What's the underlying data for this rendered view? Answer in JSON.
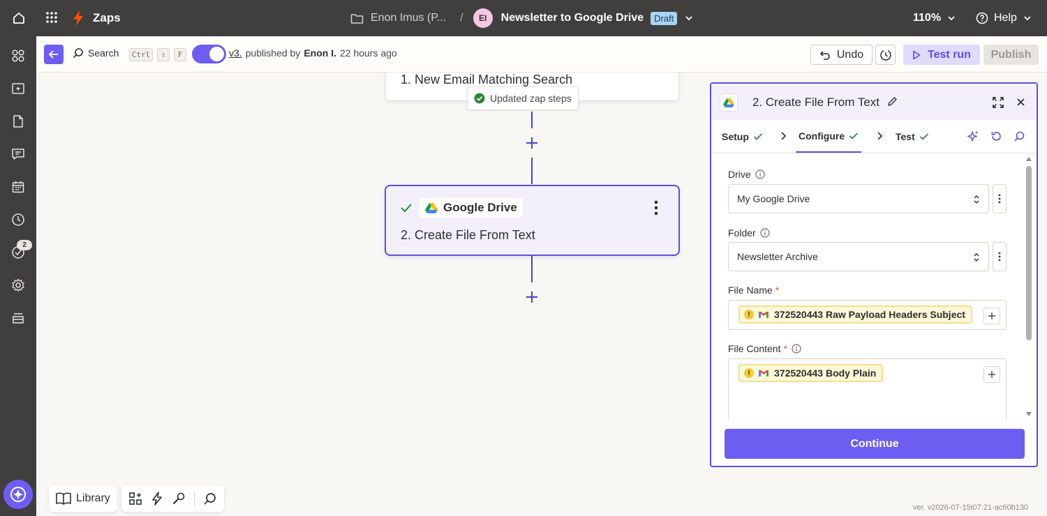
{
  "topbar": {
    "app_name": "Zaps",
    "folder_name": "Enon Imus (P...",
    "separator": "/",
    "avatar_initials": "EI",
    "zap_title": "Newsletter to Google Drive",
    "status_badge": "Draft",
    "zoom": "110%",
    "help": "Help"
  },
  "sidebar": {
    "items": [
      "apps-icon",
      "zap-history-icon",
      "documents-icon",
      "chatbot-icon",
      "calendar-icon",
      "history-icon",
      "tasks-icon",
      "settings-icon",
      "stack-icon"
    ],
    "tasks_badge": "2"
  },
  "toolbar": {
    "search_label": "Search",
    "shortcut_keys": [
      "Ctrl",
      "⇧",
      "F"
    ],
    "version": "v3.",
    "published_text_pre": "published by",
    "published_by": "Enon I.",
    "published_when": "22 hours ago",
    "undo_label": "Undo",
    "test_run_label": "Test run",
    "publish_label": "Publish"
  },
  "canvas": {
    "step1_title": "1. New Email Matching Search",
    "toast": "Updated zap steps",
    "step2_app": "Google Drive",
    "step2_title": "2. Create File From Text",
    "bottom_library": "Library",
    "version_text": "ver. v2026-07-15t07:21-ac60b130"
  },
  "panel": {
    "title": "2. Create File From Text",
    "tabs": [
      {
        "label": "Setup",
        "done": true
      },
      {
        "label": "Configure",
        "done": true,
        "active": true
      },
      {
        "label": "Test",
        "done": true
      }
    ],
    "fields": {
      "drive_label": "Drive",
      "drive_value": "My Google Drive",
      "folder_label": "Folder",
      "folder_value": "Newsletter Archive",
      "file_name_label": "File Name",
      "file_name_value": "372520443 Raw Payload Headers Subject",
      "file_content_label": "File Content",
      "file_content_value": "372520443 Body Plain",
      "required_mark": "*",
      "pill_warning": "!"
    },
    "continue_label": "Continue"
  },
  "colors": {
    "topbar_bg": "#403f3e",
    "accent": "#6b5ef0",
    "selected_border": "#5d4fd6",
    "draft_badge": "#a9d4f2",
    "zap_orange": "#ff4f00",
    "success_green": "#2e8540"
  }
}
